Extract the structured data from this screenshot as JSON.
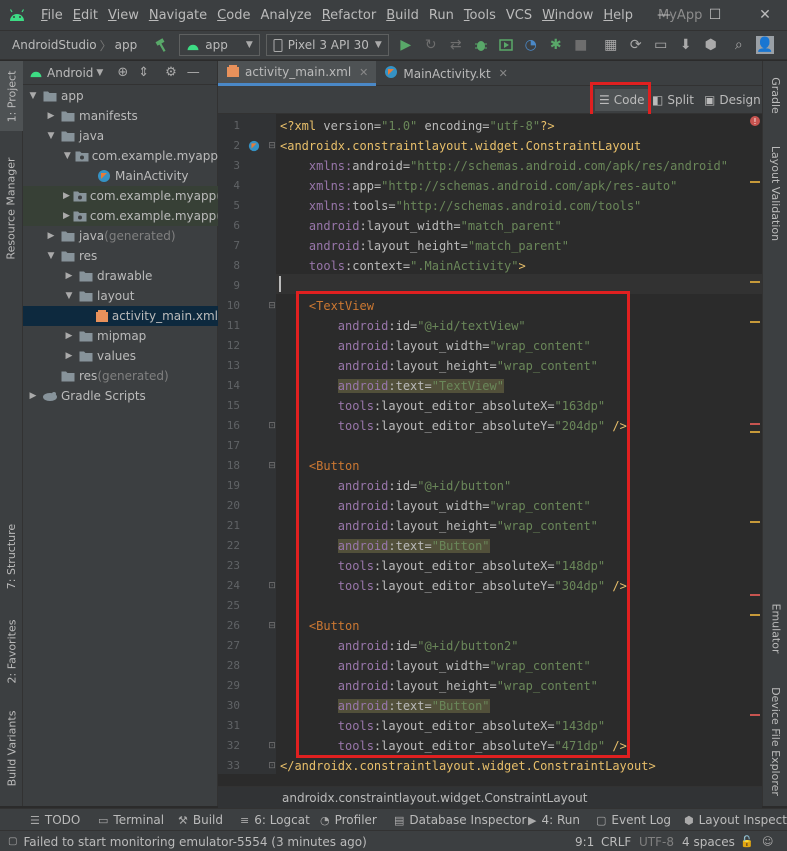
{
  "menubar": {
    "items": [
      {
        "u": "F",
        "rest": "ile"
      },
      {
        "u": "E",
        "rest": "dit"
      },
      {
        "u": "V",
        "rest": "iew"
      },
      {
        "u": "N",
        "rest": "avigate"
      },
      {
        "u": "C",
        "rest": "ode"
      },
      {
        "u": "",
        "rest": "Analyze"
      },
      {
        "u": "R",
        "rest": "efactor"
      },
      {
        "u": "B",
        "rest": "uild"
      },
      {
        "u": "",
        "rest": "Run"
      },
      {
        "u": "T",
        "rest": "ools"
      },
      {
        "u": "",
        "rest": "VCS"
      },
      {
        "u": "W",
        "rest": "indow"
      },
      {
        "u": "H",
        "rest": "elp"
      }
    ],
    "app_title": "MyApp",
    "minimize": "—",
    "maximize": "☐",
    "close": "✕"
  },
  "toolbar": {
    "project": "AndroidStudio",
    "module": "app",
    "run_config": "app",
    "device": "Pixel 3 API 30"
  },
  "left_stripe": {
    "project_tab": "1: Project",
    "resource_manager": "Resource Manager",
    "structure": "7: Structure",
    "favorites": "2: Favorites",
    "build_variants": "Build Variants"
  },
  "right_stripe": {
    "gradle": "Gradle",
    "layout_validation": "Layout Validation",
    "emulator": "Emulator",
    "device_file_explorer": "Device File Explorer"
  },
  "project_panel": {
    "view_mode": "Android",
    "tree": [
      {
        "label": "app",
        "suffix": "",
        "indent": 0,
        "toggle": "▼",
        "icon": "folder",
        "state": ""
      },
      {
        "label": "manifests",
        "suffix": "",
        "indent": 1,
        "toggle": "▶",
        "icon": "folder",
        "state": ""
      },
      {
        "label": "java",
        "suffix": "",
        "indent": 1,
        "toggle": "▼",
        "icon": "folder",
        "state": ""
      },
      {
        "label": "com.example.myapp",
        "suffix": "",
        "indent": 2,
        "toggle": "▼",
        "icon": "package",
        "state": ""
      },
      {
        "label": "MainActivity",
        "suffix": "",
        "indent": 3,
        "toggle": "",
        "icon": "kotlin",
        "state": ""
      },
      {
        "label": "com.example.myapp",
        "suffix": " (a",
        "indent": 2,
        "toggle": "▶",
        "icon": "package",
        "state": "hl"
      },
      {
        "label": "com.example.myapp",
        "suffix": " (t",
        "indent": 2,
        "toggle": "▶",
        "icon": "package",
        "state": "hl"
      },
      {
        "label": "java",
        "suffix": " (generated)",
        "indent": 1,
        "toggle": "▶",
        "icon": "folder",
        "state": ""
      },
      {
        "label": "res",
        "suffix": "",
        "indent": 1,
        "toggle": "▼",
        "icon": "folder",
        "state": ""
      },
      {
        "label": "drawable",
        "suffix": "",
        "indent": 2,
        "toggle": "▶",
        "icon": "folder",
        "state": ""
      },
      {
        "label": "layout",
        "suffix": "",
        "indent": 2,
        "toggle": "▼",
        "icon": "folder",
        "state": ""
      },
      {
        "label": "activity_main.xml",
        "suffix": "",
        "indent": 3,
        "toggle": "",
        "icon": "xml",
        "state": "sel"
      },
      {
        "label": "mipmap",
        "suffix": "",
        "indent": 2,
        "toggle": "▶",
        "icon": "folder",
        "state": ""
      },
      {
        "label": "values",
        "suffix": "",
        "indent": 2,
        "toggle": "▶",
        "icon": "folder",
        "state": ""
      },
      {
        "label": "res",
        "suffix": " (generated)",
        "indent": 1,
        "toggle": "",
        "icon": "folder",
        "state": ""
      },
      {
        "label": "Gradle Scripts",
        "suffix": "",
        "indent": 0,
        "toggle": "▶",
        "icon": "gradle",
        "state": ""
      }
    ]
  },
  "editor": {
    "tabs": [
      {
        "label": "activity_main.xml",
        "active": true
      },
      {
        "label": "MainActivity.kt",
        "active": false
      }
    ],
    "view_modes": {
      "code": "Code",
      "split": "Split",
      "design": "Design"
    },
    "footer_breadcrumb": "androidx.constraintlayout.widget.ConstraintLayout",
    "lines": [
      [
        [
          "decl",
          "<?xml "
        ],
        [
          "attr",
          "version="
        ],
        [
          "val",
          "\"1.0\""
        ],
        [
          "attr",
          " encoding="
        ],
        [
          "val",
          "\"utf-8\""
        ],
        [
          "decl",
          "?>"
        ]
      ],
      [
        [
          "tag",
          "<androidx.constraintlayout.widget.ConstraintLayout"
        ]
      ],
      [
        [
          "attr",
          "    "
        ],
        [
          "ns",
          "xmlns:"
        ],
        [
          "attr",
          "android="
        ],
        [
          "val",
          "\"http://schemas.android.com/apk/res/android\""
        ]
      ],
      [
        [
          "attr",
          "    "
        ],
        [
          "ns",
          "xmlns:"
        ],
        [
          "attr",
          "app="
        ],
        [
          "val",
          "\"http://schemas.android.com/apk/res-auto\""
        ]
      ],
      [
        [
          "attr",
          "    "
        ],
        [
          "ns",
          "xmlns:"
        ],
        [
          "attr",
          "tools="
        ],
        [
          "val",
          "\"http://schemas.android.com/tools\""
        ]
      ],
      [
        [
          "attr",
          "    "
        ],
        [
          "ns",
          "android"
        ],
        [
          "attr",
          ":layout_width="
        ],
        [
          "val",
          "\"match_parent\""
        ]
      ],
      [
        [
          "attr",
          "    "
        ],
        [
          "ns",
          "android"
        ],
        [
          "attr",
          ":layout_height="
        ],
        [
          "val",
          "\"match_parent\""
        ]
      ],
      [
        [
          "attr",
          "    "
        ],
        [
          "ns",
          "tools"
        ],
        [
          "attr",
          ":context="
        ],
        [
          "val",
          "\".MainActivity\""
        ],
        [
          "tag",
          ">"
        ]
      ],
      [],
      [
        [
          "attr",
          "    "
        ],
        [
          "tagred",
          "<TextView"
        ]
      ],
      [
        [
          "attr",
          "        "
        ],
        [
          "ns",
          "android"
        ],
        [
          "attr",
          ":id="
        ],
        [
          "val",
          "\"@+id/textView\""
        ]
      ],
      [
        [
          "attr",
          "        "
        ],
        [
          "ns",
          "android"
        ],
        [
          "attr",
          ":layout_width="
        ],
        [
          "val",
          "\"wrap_content\""
        ]
      ],
      [
        [
          "attr",
          "        "
        ],
        [
          "ns",
          "android"
        ],
        [
          "attr",
          ":layout_height="
        ],
        [
          "val",
          "\"wrap_content\""
        ]
      ],
      [
        [
          "attr",
          "        "
        ],
        [
          "nswarn",
          "android"
        ],
        [
          "attrwarn",
          ":text="
        ],
        [
          "valwarn",
          "\"TextView\""
        ]
      ],
      [
        [
          "attr",
          "        "
        ],
        [
          "ns",
          "tools"
        ],
        [
          "attr",
          ":layout_editor_absoluteX="
        ],
        [
          "val",
          "\"163dp\""
        ]
      ],
      [
        [
          "attr",
          "        "
        ],
        [
          "ns",
          "tools"
        ],
        [
          "attr",
          ":layout_editor_absoluteY="
        ],
        [
          "val",
          "\"204dp\""
        ],
        [
          "tag",
          " />"
        ]
      ],
      [],
      [
        [
          "attr",
          "    "
        ],
        [
          "tagred",
          "<Button"
        ]
      ],
      [
        [
          "attr",
          "        "
        ],
        [
          "ns",
          "android"
        ],
        [
          "attr",
          ":id="
        ],
        [
          "val",
          "\"@+id/button\""
        ]
      ],
      [
        [
          "attr",
          "        "
        ],
        [
          "ns",
          "android"
        ],
        [
          "attr",
          ":layout_width="
        ],
        [
          "val",
          "\"wrap_content\""
        ]
      ],
      [
        [
          "attr",
          "        "
        ],
        [
          "ns",
          "android"
        ],
        [
          "attr",
          ":layout_height="
        ],
        [
          "val",
          "\"wrap_content\""
        ]
      ],
      [
        [
          "attr",
          "        "
        ],
        [
          "nswarn",
          "android"
        ],
        [
          "attrwarn",
          ":text="
        ],
        [
          "valwarn",
          "\"Button\""
        ]
      ],
      [
        [
          "attr",
          "        "
        ],
        [
          "ns",
          "tools"
        ],
        [
          "attr",
          ":layout_editor_absoluteX="
        ],
        [
          "val",
          "\"148dp\""
        ]
      ],
      [
        [
          "attr",
          "        "
        ],
        [
          "ns",
          "tools"
        ],
        [
          "attr",
          ":layout_editor_absoluteY="
        ],
        [
          "val",
          "\"304dp\""
        ],
        [
          "tag",
          " />"
        ]
      ],
      [],
      [
        [
          "attr",
          "    "
        ],
        [
          "tagred",
          "<Button"
        ]
      ],
      [
        [
          "attr",
          "        "
        ],
        [
          "ns",
          "android"
        ],
        [
          "attr",
          ":id="
        ],
        [
          "val",
          "\"@+id/button2\""
        ]
      ],
      [
        [
          "attr",
          "        "
        ],
        [
          "ns",
          "android"
        ],
        [
          "attr",
          ":layout_width="
        ],
        [
          "val",
          "\"wrap_content\""
        ]
      ],
      [
        [
          "attr",
          "        "
        ],
        [
          "ns",
          "android"
        ],
        [
          "attr",
          ":layout_height="
        ],
        [
          "val",
          "\"wrap_content\""
        ]
      ],
      [
        [
          "attr",
          "        "
        ],
        [
          "nswarn",
          "android"
        ],
        [
          "attrwarn",
          ":text="
        ],
        [
          "valwarn",
          "\"Button\""
        ]
      ],
      [
        [
          "attr",
          "        "
        ],
        [
          "ns",
          "tools"
        ],
        [
          "attr",
          ":layout_editor_absoluteX="
        ],
        [
          "val",
          "\"143dp\""
        ]
      ],
      [
        [
          "attr",
          "        "
        ],
        [
          "ns",
          "tools"
        ],
        [
          "attr",
          ":layout_editor_absoluteY="
        ],
        [
          "val",
          "\"471dp\""
        ],
        [
          "tag",
          " />"
        ]
      ],
      [
        [
          "tag",
          "</androidx.constraintlayout.widget.ConstraintLayout>"
        ]
      ]
    ]
  },
  "bottom_tools": {
    "todo": "TODO",
    "terminal": "Terminal",
    "build": "Build",
    "logcat": "6: Logcat",
    "profiler": "Profiler",
    "database_inspector": "Database Inspector",
    "run": "4: Run",
    "event_log": "Event Log",
    "layout_inspector": "Layout Inspector"
  },
  "status": {
    "message": "Failed to start monitoring emulator-5554 (3 minutes ago)",
    "position": "9:1",
    "line_sep": "CRLF",
    "encoding": "UTF-8",
    "indent": "4 spaces"
  },
  "colors": {
    "accent": "#4a88c7",
    "highlight_box": "#e02020",
    "run_green": "#59a869"
  }
}
